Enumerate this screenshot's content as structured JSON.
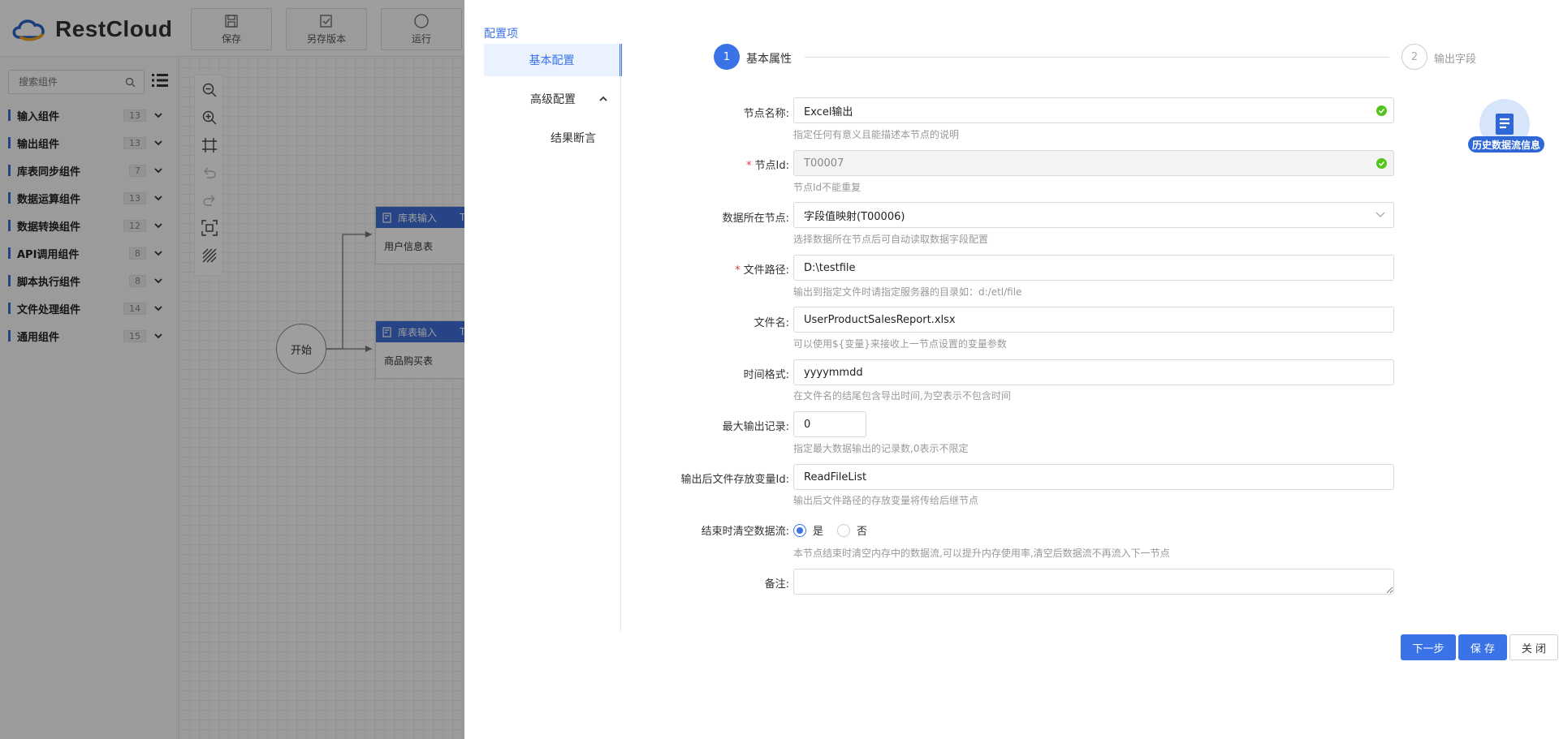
{
  "app": {
    "brand": "RestCloud",
    "toolbar": [
      {
        "label": "保存",
        "icon": "save-icon"
      },
      {
        "label": "另存版本",
        "icon": "save-version-icon"
      },
      {
        "label": "运行",
        "icon": "run-icon"
      }
    ]
  },
  "sidebar": {
    "search_placeholder": "搜索组件",
    "categories": [
      {
        "label": "输入组件",
        "count": "13"
      },
      {
        "label": "输出组件",
        "count": "13"
      },
      {
        "label": "库表同步组件",
        "count": "7"
      },
      {
        "label": "数据运算组件",
        "count": "13"
      },
      {
        "label": "数据转换组件",
        "count": "12"
      },
      {
        "label": "API调用组件",
        "count": "8"
      },
      {
        "label": "脚本执行组件",
        "count": "8"
      },
      {
        "label": "文件处理组件",
        "count": "14"
      },
      {
        "label": "通用组件",
        "count": "15"
      }
    ]
  },
  "canvas": {
    "start_label": "开始",
    "nodes": [
      {
        "type": "库表输入",
        "suffix": "T",
        "name": "用户信息表"
      },
      {
        "type": "库表输入",
        "suffix": "T",
        "name": "商品购买表"
      }
    ]
  },
  "drawer": {
    "title": "配置项",
    "nav": {
      "basic": "基本配置",
      "advanced": "高级配置",
      "assert": "结果断言"
    },
    "steps": [
      {
        "num": "1",
        "label": "基本属性"
      },
      {
        "num": "2",
        "label": "输出字段"
      }
    ],
    "form": {
      "node_name": {
        "label": "节点名称:",
        "value": "Excel输出",
        "help": "指定任何有意义且能描述本节点的说明"
      },
      "node_id": {
        "label": "节点Id:",
        "value": "T00007",
        "help": "节点Id不能重复"
      },
      "source_node": {
        "label": "数据所在节点:",
        "value": "字段值映射(T00006)",
        "help": "选择数据所在节点后可自动读取数据字段配置"
      },
      "file_path": {
        "label": "文件路径:",
        "value": "D:\\testfile",
        "help": "输出到指定文件时请指定服务器的目录如：d:/etl/file"
      },
      "file_name": {
        "label": "文件名:",
        "value": "UserProductSalesReport.xlsx",
        "help": "可以使用${变量}来接收上一节点设置的变量参数"
      },
      "time_format": {
        "label": "时间格式:",
        "value": "yyyymmdd",
        "help": "在文件名的结尾包含导出时间,为空表示不包含时间"
      },
      "max_records": {
        "label": "最大输出记录:",
        "value": "0",
        "help": "指定最大数据输出的记录数,0表示不限定"
      },
      "output_var": {
        "label": "输出后文件存放变量Id:",
        "value": "ReadFileList",
        "help": "输出后文件路径的存放变量将传给后继节点"
      },
      "clear_stream": {
        "label": "结束时清空数据流:",
        "yes": "是",
        "no": "否",
        "selected": "是",
        "help": "本节点结束时清空内存中的数据流,可以提升内存使用率,清空后数据流不再流入下一节点"
      },
      "remark": {
        "label": "备注:",
        "value": ""
      }
    },
    "buttons": {
      "next": "下一步",
      "save": "保 存",
      "close": "关 闭"
    },
    "history_label": "历史数据流信息"
  },
  "colors": {
    "primary": "#3a73e8",
    "success": "#52c41a",
    "required": "#e0383e"
  }
}
